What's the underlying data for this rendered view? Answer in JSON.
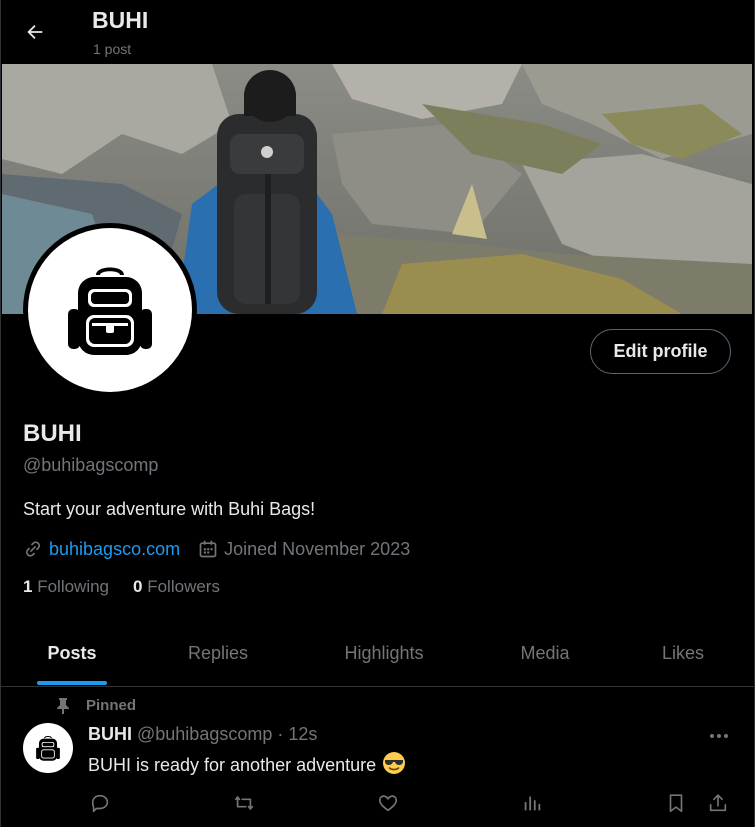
{
  "header": {
    "title": "BUHI",
    "post_count": "1 post"
  },
  "profile": {
    "display_name": "BUHI",
    "handle": "@buhibagscomp",
    "bio": "Start your adventure with Buhi Bags!",
    "website": "buhibagsco.com",
    "joined": "Joined November 2023",
    "following_count": "1",
    "following_label": "Following",
    "followers_count": "0",
    "followers_label": "Followers",
    "edit_label": "Edit profile"
  },
  "tabs": [
    {
      "label": "Posts",
      "active": true
    },
    {
      "label": "Replies"
    },
    {
      "label": "Highlights"
    },
    {
      "label": "Media"
    },
    {
      "label": "Likes"
    }
  ],
  "post": {
    "pinned_label": "Pinned",
    "author": "BUHI",
    "meta": "@buhibagscomp · 12s",
    "text": "BUHI is ready for another adventure",
    "emoji": "smiling-face-with-sunglasses"
  },
  "icons": [
    "back-arrow-icon",
    "backpack-icon",
    "link-icon",
    "calendar-icon",
    "pin-icon",
    "more-icon",
    "reply-icon",
    "repost-icon",
    "like-icon",
    "views-icon",
    "bookmark-icon",
    "share-icon"
  ],
  "colors": {
    "accent": "#1d9bf0",
    "background": "#000000",
    "text": "#e7e9ea",
    "muted": "#71767b",
    "border": "#2f3336"
  }
}
